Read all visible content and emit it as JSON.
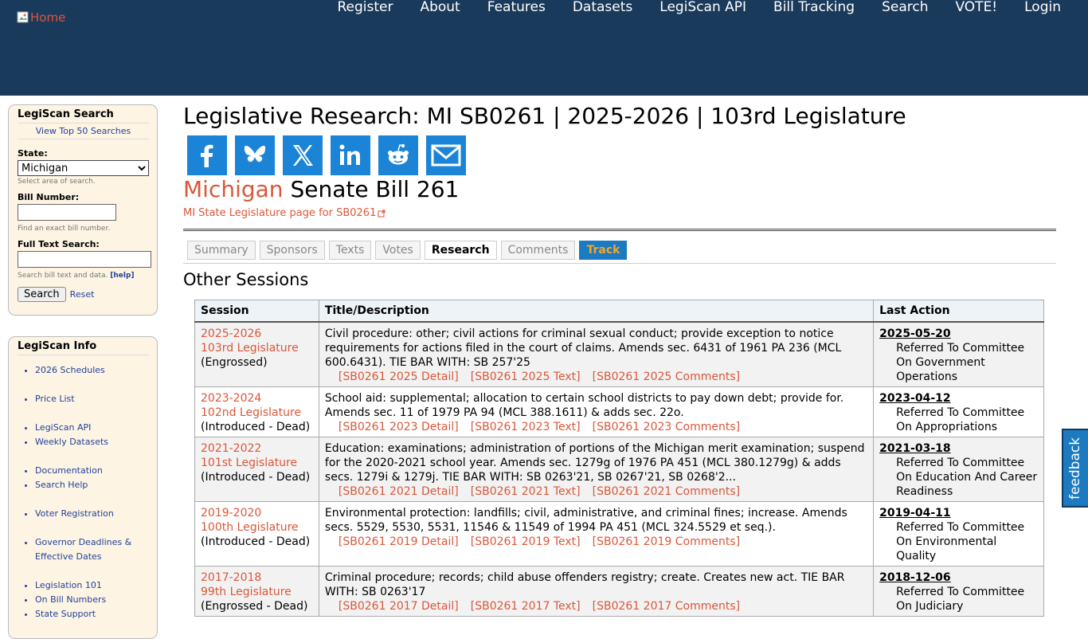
{
  "header": {
    "home_alt": "Home",
    "nav": [
      "Register",
      "About",
      "Features",
      "Datasets",
      "LegiScan API",
      "Bill Tracking",
      "Search",
      "VOTE!",
      "Login"
    ]
  },
  "sidebar": {
    "search": {
      "title": "LegiScan Search",
      "top50": "View Top 50 Searches",
      "state_label": "State:",
      "state_value": "Michigan",
      "state_hint": "Select area of search.",
      "bill_label": "Bill Number:",
      "bill_value": "",
      "bill_hint": "Find an exact bill number.",
      "fulltext_label": "Full Text Search:",
      "fulltext_value": "",
      "fulltext_hint": "Search bill text and data.",
      "help_label": "[help]",
      "search_button": "Search",
      "reset_label": "Reset"
    },
    "info": {
      "title": "LegiScan Info",
      "items": [
        "2026 Schedules",
        "Price List",
        "LegiScan API",
        "Weekly Datasets",
        "Documentation",
        "Search Help",
        "Voter Registration",
        "Governor Deadlines & Effective Dates",
        "Legislation 101",
        "On Bill Numbers",
        "State Support"
      ]
    }
  },
  "main": {
    "title": "Legislative Research: MI SB0261 | 2025-2026 | 103rd Legislature",
    "share_icons": [
      "facebook-icon",
      "bluesky-icon",
      "x-icon",
      "linkedin-icon",
      "reddit-icon",
      "email-icon"
    ],
    "bill_state": "Michigan",
    "bill_name": "Senate Bill 261",
    "state_link": "MI State Legislature page for SB0261",
    "tabs": [
      "Summary",
      "Sponsors",
      "Texts",
      "Votes",
      "Research",
      "Comments",
      "Track"
    ],
    "active_tab": "Research",
    "section_title": "Other Sessions",
    "table": {
      "headers": [
        "Session",
        "Title/Description",
        "Last Action"
      ],
      "rows": [
        {
          "years": "2025-2026",
          "legislature": "103rd Legislature",
          "status": "(Engrossed)",
          "description": "Civil procedure: other; civil actions for criminal sexual conduct; provide exception to notice requirements for actions filed in the court of claims. Amends sec. 6431 of 1961 PA 236 (MCL 600.6431). TIE BAR WITH: SB 257'25",
          "links": [
            "[SB0261 2025 Detail]",
            "[SB0261 2025 Text]",
            "[SB0261 2025 Comments]"
          ],
          "last_date": "2025-05-20",
          "last_action": "Referred To Committee On Government Operations"
        },
        {
          "years": "2023-2024",
          "legislature": "102nd Legislature",
          "status": "(Introduced - Dead)",
          "description": "School aid: supplemental; allocation to certain school districts to pay down debt; provide for. Amends sec. 11 of 1979 PA 94 (MCL 388.1611) & adds sec. 22o.",
          "links": [
            "[SB0261 2023 Detail]",
            "[SB0261 2023 Text]",
            "[SB0261 2023 Comments]"
          ],
          "last_date": "2023-04-12",
          "last_action": "Referred To Committee On Appropriations"
        },
        {
          "years": "2021-2022",
          "legislature": "101st Legislature",
          "status": "(Introduced - Dead)",
          "description": "Education: examinations; administration of portions of the Michigan merit examination; suspend for the 2020-2021 school year. Amends sec. 1279g of 1976 PA 451 (MCL 380.1279g) & adds secs. 1279i & 1279j. TIE BAR WITH: SB 0263'21, SB 0267'21, SB 0268'2...",
          "links": [
            "[SB0261 2021 Detail]",
            "[SB0261 2021 Text]",
            "[SB0261 2021 Comments]"
          ],
          "last_date": "2021-03-18",
          "last_action": "Referred To Committee On Education And Career Readiness"
        },
        {
          "years": "2019-2020",
          "legislature": "100th Legislature",
          "status": "(Introduced - Dead)",
          "description": "Environmental protection: landfills; civil, administrative, and criminal fines; increase. Amends secs. 5529, 5530, 5531, 11546 & 11549 of 1994 PA 451 (MCL 324.5529 et seq.).",
          "links": [
            "[SB0261 2019 Detail]",
            "[SB0261 2019 Text]",
            "[SB0261 2019 Comments]"
          ],
          "last_date": "2019-04-11",
          "last_action": "Referred To Committee On Environmental Quality"
        },
        {
          "years": "2017-2018",
          "legislature": "99th Legislature",
          "status": "(Engrossed - Dead)",
          "description": "Criminal procedure; records; child abuse offenders registry; create. Creates new act. TIE BAR WITH: SB 0263'17",
          "links": [
            "[SB0261 2017 Detail]",
            "[SB0261 2017 Text]",
            "[SB0261 2017 Comments]"
          ],
          "last_date": "2018-12-06",
          "last_action": "Referred To Committee On Judiciary"
        }
      ]
    }
  },
  "feedback_label": "feedback"
}
